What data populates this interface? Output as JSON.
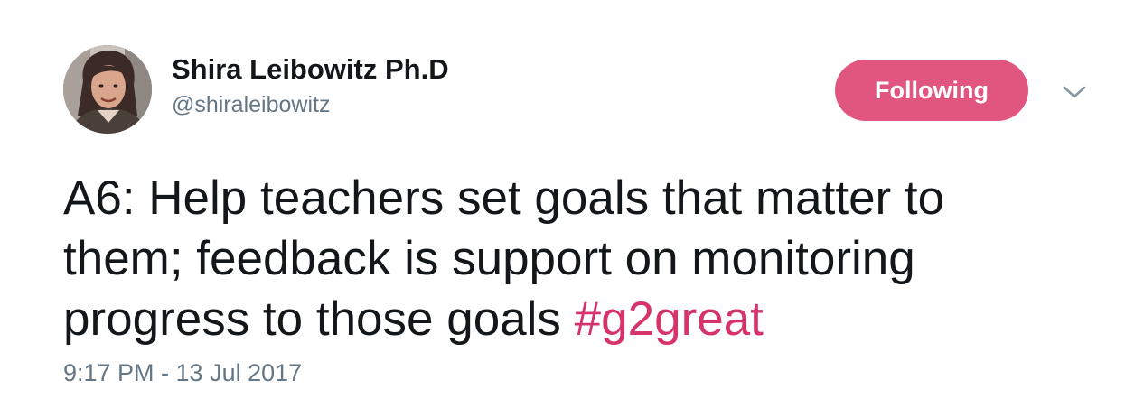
{
  "tweet": {
    "user": {
      "display_name": "Shira Leibowitz Ph.D",
      "handle": "@shiraleibowitz"
    },
    "follow_button_label": "Following",
    "menu_icon": "chevron-down-icon",
    "text_lines": [
      "A6: Help teachers set goals that matter to",
      "them; feedback is support on monitoring",
      "progress to those goals "
    ],
    "hashtag": "#g2great",
    "timestamp": "9:17 PM - 13 Jul 2017"
  },
  "colors": {
    "follow_button": "#e0567f",
    "hashtag": "#d6336c",
    "secondary_text": "#657786",
    "primary_text": "#14171a"
  }
}
